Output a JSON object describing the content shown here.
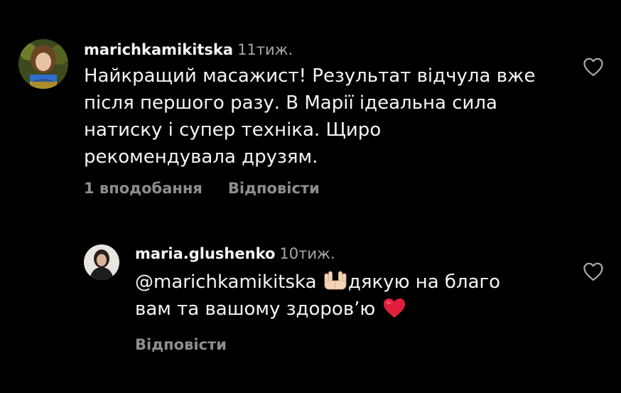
{
  "colors": {
    "background": "#000000",
    "text": "#f5f5f5",
    "muted": "#8e8e8e",
    "timestamp": "#a8a8a8",
    "heart_emoji": "#e0203a"
  },
  "comments": [
    {
      "username": "marichkamikitska",
      "time": "11тиж.",
      "text": "Найкращий масажист! Результат відчула вже після першого разу. В Марії ідеальна сила натиску і супер техніка. Щиро рекомендувала друзям.",
      "likes": "1 вподобання",
      "reply": "Відповісти",
      "like_icon": "heart-outline-icon"
    },
    {
      "username": "maria.glushenko",
      "time": "10тиж.",
      "mention": "@marichkamikitska",
      "emoji_1": "palms-up-together-emoji",
      "text_part_1": "дякую на благо",
      "text_part_2": "вам та вашому здоров’ю",
      "emoji_2": "red-heart-emoji",
      "reply": "Відповісти",
      "like_icon": "heart-outline-icon"
    }
  ]
}
